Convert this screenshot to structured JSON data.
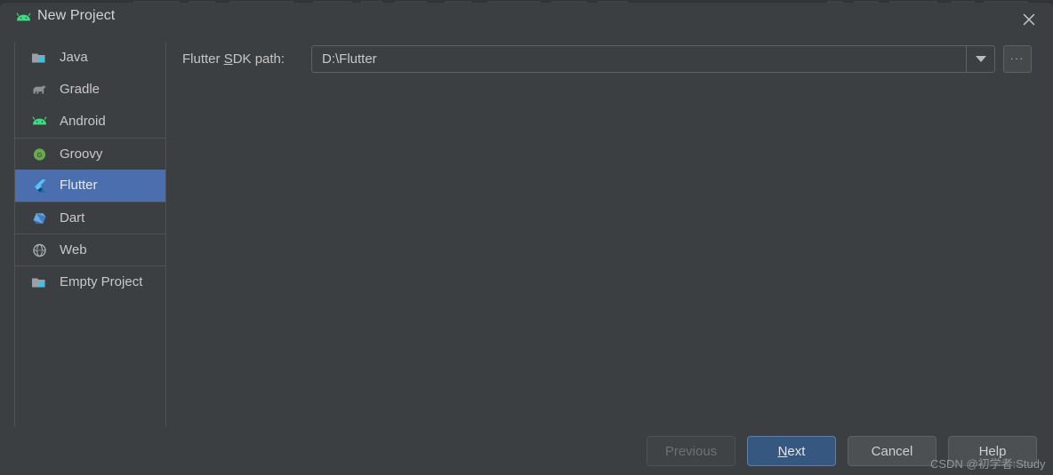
{
  "window": {
    "title": "New Project",
    "title_icon": "android-logo-icon",
    "close_icon": "close-icon"
  },
  "sidebar": {
    "items": [
      {
        "label": "Java",
        "icon": "java-folder-icon",
        "selected": false,
        "separator_above": false
      },
      {
        "label": "Gradle",
        "icon": "gradle-elephant-icon",
        "selected": false,
        "separator_above": false
      },
      {
        "label": "Android",
        "icon": "android-logo-icon",
        "selected": false,
        "separator_above": false
      },
      {
        "label": "Groovy",
        "icon": "groovy-icon",
        "selected": false,
        "separator_above": true
      },
      {
        "label": "Flutter",
        "icon": "flutter-logo-icon",
        "selected": true,
        "separator_above": false
      },
      {
        "label": "Dart",
        "icon": "dart-logo-icon",
        "selected": false,
        "separator_above": true
      },
      {
        "label": "Web",
        "icon": "globe-icon",
        "selected": false,
        "separator_above": true
      },
      {
        "label": "Empty Project",
        "icon": "folder-icon",
        "selected": false,
        "separator_above": true
      }
    ]
  },
  "form": {
    "sdk_path_label_before": "Flutter ",
    "sdk_path_label_mnemonic": "S",
    "sdk_path_label_after": "DK path:",
    "sdk_path_value": "D:\\Flutter",
    "dropdown_icon": "chevron-down-icon",
    "browse_label": "...",
    "browse_icon": "ellipsis-icon"
  },
  "buttons": {
    "previous": "Previous",
    "next_before": "",
    "next_mnemonic": "N",
    "next_after": "ext",
    "cancel": "Cancel",
    "help": "Help"
  },
  "watermark": {
    "text": "CSDN @初学者:Study"
  },
  "colors": {
    "dialog_background": "#3c3f41",
    "selection_blue": "#4b6eaf",
    "primary_button": "#365880",
    "text": "#c8c8c8",
    "border": "#5e6264",
    "android_green": "#3ddc84",
    "flutter_blue": "#54c5f8",
    "dart_blue": "#4a8fd4",
    "groovy_green": "#6aa84f",
    "folder_accent": "#35c3ee"
  }
}
